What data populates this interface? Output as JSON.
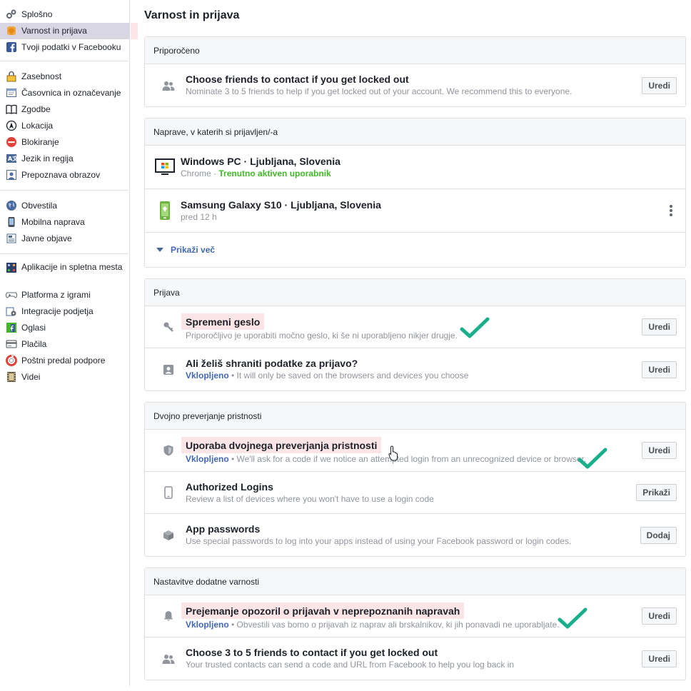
{
  "sidebar": {
    "group1": [
      {
        "label": "Splošno",
        "icon": "gears-icon"
      },
      {
        "label": "Varnost in prijava",
        "icon": "shield-badge-icon"
      },
      {
        "label": "Tvoji podatki v Facebooku",
        "icon": "facebook-icon"
      }
    ],
    "group2": [
      {
        "label": "Zasebnost",
        "icon": "lock-icon"
      },
      {
        "label": "Časovnica in označevanje",
        "icon": "timeline-icon"
      },
      {
        "label": "Zgodbe",
        "icon": "book-icon"
      },
      {
        "label": "Lokacija",
        "icon": "location-icon"
      },
      {
        "label": "Blokiranje",
        "icon": "block-icon"
      },
      {
        "label": "Jezik in regija",
        "icon": "language-icon"
      },
      {
        "label": "Prepoznava obrazov",
        "icon": "face-icon"
      }
    ],
    "group3": [
      {
        "label": "Obvestila",
        "icon": "globe-icon"
      },
      {
        "label": "Mobilna naprava",
        "icon": "mobile-icon"
      },
      {
        "label": "Javne objave",
        "icon": "public-posts-icon"
      }
    ],
    "group4": [
      {
        "label": "Aplikacije in spletna mesta",
        "icon": "apps-icon"
      },
      {
        "label": "Platforma z igrami",
        "icon": "gamepad-icon"
      },
      {
        "label": "Integracije podjetja",
        "icon": "business-gear-icon"
      },
      {
        "label": "Oglasi",
        "icon": "ads-icon"
      },
      {
        "label": "Plačila",
        "icon": "payments-icon"
      },
      {
        "label": "Poštni predal podpore",
        "icon": "lifebuoy-icon"
      },
      {
        "label": "Videi",
        "icon": "film-icon"
      }
    ]
  },
  "main": {
    "title": "Varnost in prijava",
    "recommended": {
      "heading": "Priporočeno",
      "row": {
        "title": "Choose friends to contact if you get locked out",
        "desc": "Nominate 3 to 5 friends to help if you get locked out of your account. We recommend this to everyone.",
        "button": "Uredi"
      }
    },
    "devices": {
      "heading": "Naprave, v katerih si prijavljen/-a",
      "items": [
        {
          "title": "Windows PC · Ljubljana, Slovenia",
          "browser": "Chrome",
          "sep": " · ",
          "status": "Trenutno aktiven uporabnik"
        },
        {
          "title": "Samsung Galaxy S10 · Ljubljana, Slovenia",
          "time": "pred 12 h",
          "more": "⋮"
        }
      ],
      "show_more": "Prikaži več"
    },
    "login": {
      "heading": "Prijava",
      "rows": [
        {
          "title": "Spremeni geslo",
          "desc": "Priporočljivo je uporabiti močno geslo, ki še ni uporabljeno nikjer drugje.",
          "button": "Uredi"
        },
        {
          "title": "Ali želiš shraniti podatke za prijavo?",
          "status": "Vklopljeno",
          "desc": " • It will only be saved on the browsers and devices you choose",
          "button": "Uredi"
        }
      ]
    },
    "twofactor": {
      "heading": "Dvojno preverjanje pristnosti",
      "rows": [
        {
          "title": "Uporaba dvojnega preverjanja pristnosti",
          "status": "Vklopljeno",
          "desc": " • We'll ask for a code if we notice an attempted login from an unrecognized device or browser.",
          "button": "Uredi"
        },
        {
          "title": "Authorized Logins",
          "desc": "Review a list of devices where you won't have to use a login code",
          "button": "Prikaži"
        },
        {
          "title": "App passwords",
          "desc": "Use special passwords to log into your apps instead of using your Facebook password or login codes.",
          "button": "Dodaj"
        }
      ]
    },
    "extra": {
      "heading": "Nastavitve dodatne varnosti",
      "rows": [
        {
          "title": "Prejemanje opozoril o prijavah v neprepoznanih napravah",
          "status": "Vklopljeno",
          "desc": " • Obvestili vas bomo o prijavah iz naprav ali brskalnikov, ki jih ponavadi ne uporabljate.",
          "button": "Uredi"
        },
        {
          "title": "Choose 3 to 5 friends to contact if you get locked out",
          "desc": "Your trusted contacts can send a code and URL from Facebook to help you log back in",
          "button": "Uredi"
        }
      ]
    }
  },
  "colors": {
    "link": "#4267b2",
    "active_green": "#42b72a",
    "highlight": "#fbe5e6",
    "check_teal": "#1aaf8b",
    "sidebar_active": "#d9d6e4"
  }
}
